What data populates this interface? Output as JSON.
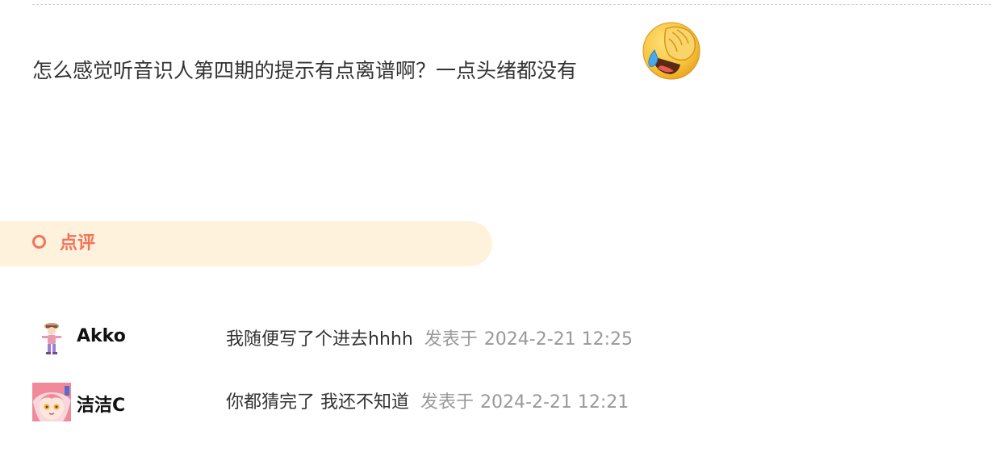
{
  "post": {
    "text": "怎么感觉听音识人第四期的提示有点离谱啊？一点头绪都没有",
    "emoji": "facepalm-laughing-emoji"
  },
  "comments_section": {
    "title": "点评",
    "accent_color": "#f2735a",
    "banner_color": "#fff2dd"
  },
  "comments": [
    {
      "username": "Akko",
      "text": "我随便写了个进去hhhh",
      "posted_label": "发表于",
      "timestamp": "2024-2-21 12:25"
    },
    {
      "username": "洁洁C",
      "text": "你都猜完了 我还不知道",
      "posted_label": "发表于",
      "timestamp": "2024-2-21 12:21"
    }
  ]
}
